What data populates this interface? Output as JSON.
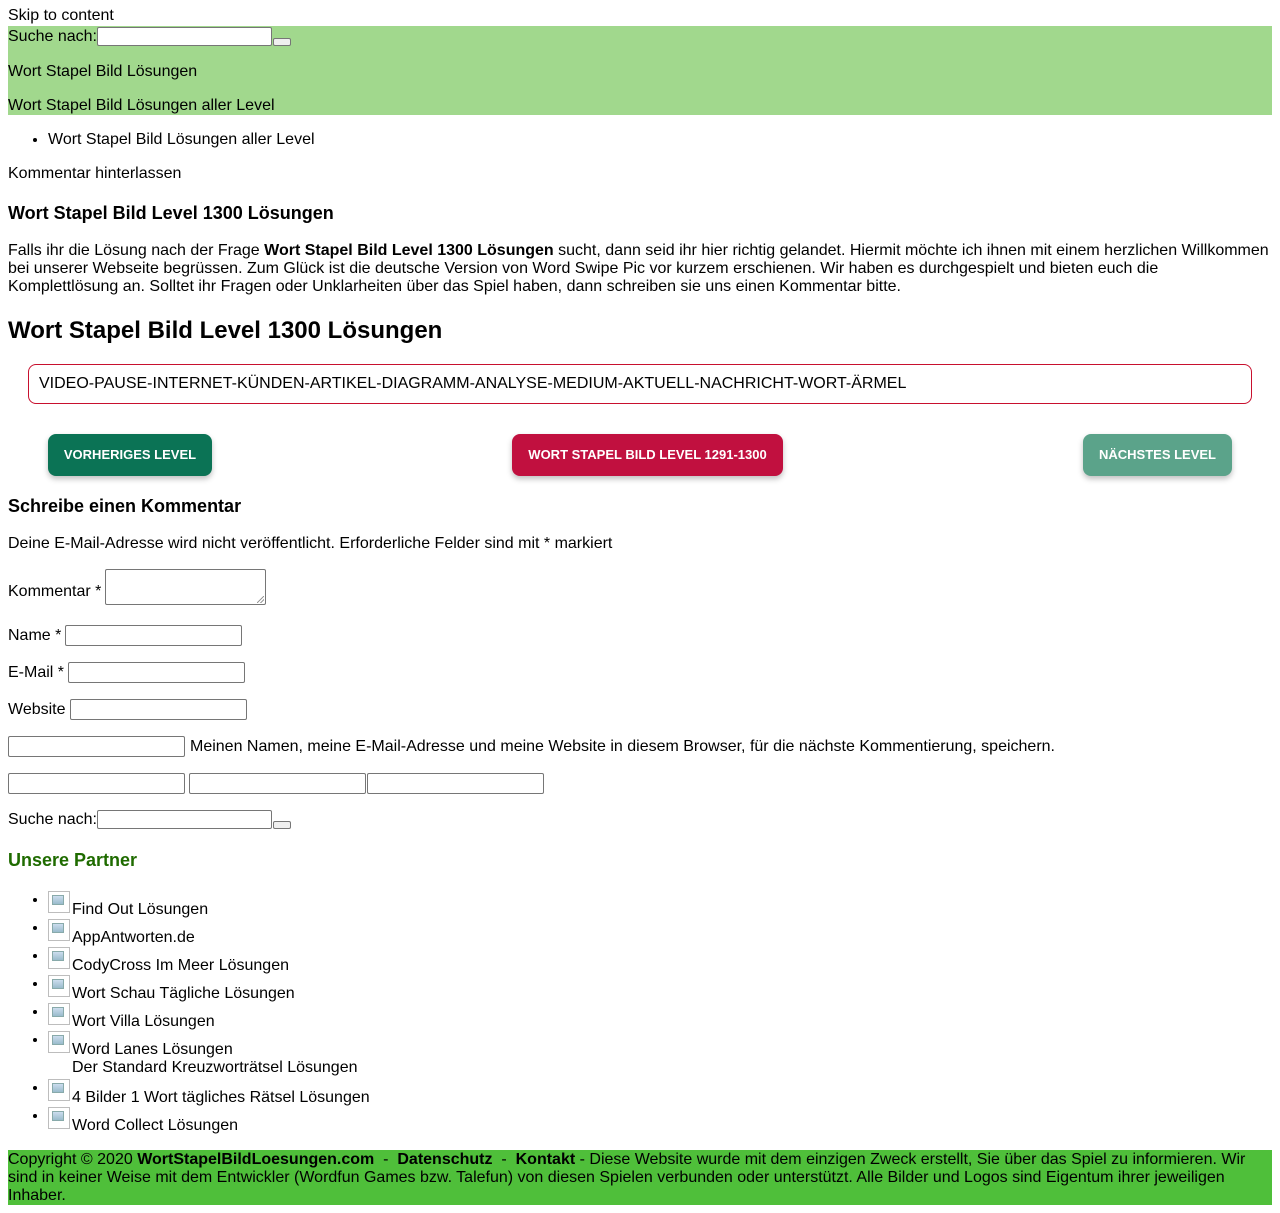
{
  "skip_link": "Skip to content",
  "header": {
    "search_label": "Suche nach:",
    "site_title": "Wort Stapel Bild Lösungen",
    "site_description": "Wort Stapel Bild Lösungen aller Level",
    "background_color": "#a1d88d"
  },
  "breadcrumb": [
    "Wort Stapel Bild Lösungen aller Level"
  ],
  "comment_link": "Kommentar hinterlassen",
  "post": {
    "title": "Wort Stapel Bild Level 1300 Lösungen",
    "intro_before": "Falls ihr die Lösung nach der Frage ",
    "intro_bold": "Wort Stapel Bild Level 1300 Lösungen",
    "intro_after": " sucht, dann seid ihr hier richtig gelandet. Hiermit möchte ich ihnen mit einem herzlichen Willkommen bei unserer Webseite begrüssen. Zum Glück ist die deutsche Version von Word Swipe Pic vor kurzem erschienen. Wir haben es durchgespielt und bieten euch die Komplettlösung an. Solltet ihr Fragen oder Unklarheiten über das Spiel haben, dann schreiben sie uns einen Kommentar bitte.",
    "main_heading": "Wort Stapel Bild Level 1300 Lösungen",
    "answer": "VIDEO-PAUSE-INTERNET-KÜNDEN-ARTIKEL-DIAGRAMM-ANALYSE-MEDIUM-AKTUELL-NACHRICHT-WORT-ÄRMEL"
  },
  "nav_buttons": {
    "prev": "VORHERIGES LEVEL",
    "list": "WORT STAPEL BILD LEVEL 1291-1300",
    "next": "NÄCHSTES LEVEL",
    "prev_color": "#0b7355",
    "list_color": "#c1103f",
    "next_color": "#5ba38a"
  },
  "comment_form": {
    "title": "Schreibe einen Kommentar",
    "notes": "Deine E-Mail-Adresse wird nicht veröffentlicht. Erforderliche Felder sind mit * markiert",
    "comment_label": "Kommentar *",
    "name_label": "Name *",
    "email_label": "E-Mail *",
    "website_label": "Website",
    "cookie_label": "Meinen Namen, meine E-Mail-Adresse und meine Website in diesem Browser, für die nächste Kommentierung, speichern."
  },
  "sidebar": {
    "search_label": "Suche nach:",
    "partners_title": "Unsere Partner",
    "partners": [
      "Find Out Lösungen",
      "AppAntworten.de",
      "CodyCross Im Meer Lösungen",
      "Wort Schau Tägliche Lösungen",
      "Wort Villa Lösungen",
      "Word Lanes Lösungen",
      "Der Standard Kreuzworträtsel Lösungen",
      "4 Bilder 1 Wort tägliches Rätsel Lösungen",
      "Word Collect Lösungen"
    ]
  },
  "footer": {
    "copyright": "Copyright © 2020 ",
    "site_link": "WortStapelBildLoesungen.com",
    "sep1": "  -  ",
    "privacy_link": "Datenschutz",
    "sep2": "  -  ",
    "contact_link": "Kontakt",
    "disclaimer": "  - Diese Website wurde mit dem einzigen Zweck erstellt, Sie über das Spiel zu informieren. Wir sind in keiner Weise mit dem Entwickler (Wordfun Games bzw. Talefun) von diesen Spielen verbunden oder unterstützt. Alle Bilder und Logos sind Eigentum ihrer jeweiligen Inhaber.",
    "background_color": "#4fbf3a"
  }
}
